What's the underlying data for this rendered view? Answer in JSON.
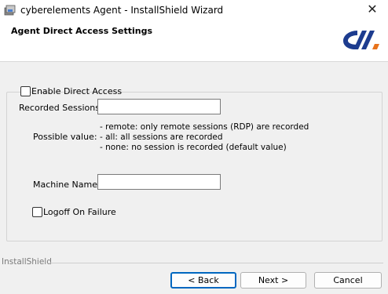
{
  "window": {
    "title": "cyberelements Agent - InstallShield Wizard",
    "close_glyph": "✕"
  },
  "header": {
    "title": "Agent Direct Access Settings",
    "logo_icon": "cyberelements-logo",
    "logo_colors": [
      "#1d3c8f",
      "#e8731c"
    ]
  },
  "form": {
    "enable_direct_access": {
      "label": "Enable Direct Access",
      "checked": false
    },
    "recorded_sessions": {
      "label": "Recorded Sessions:",
      "value": ""
    },
    "possible_value": {
      "label": "Possible value:",
      "lines": [
        "- remote: only remote sessions (RDP) are recorded",
        "- all: all sessions are recorded",
        "- none: no session is recorded (default value)"
      ]
    },
    "machine_name": {
      "label": "Machine Name:",
      "value": ""
    },
    "logoff_on_failure": {
      "label": "Logoff On Failure",
      "checked": false
    }
  },
  "footer": {
    "brand": "InstallShield",
    "back_label": "< Back",
    "next_label": "Next >",
    "cancel_label": "Cancel"
  },
  "colors": {
    "accent": "#0067c0",
    "background": "#f0f0f0"
  }
}
